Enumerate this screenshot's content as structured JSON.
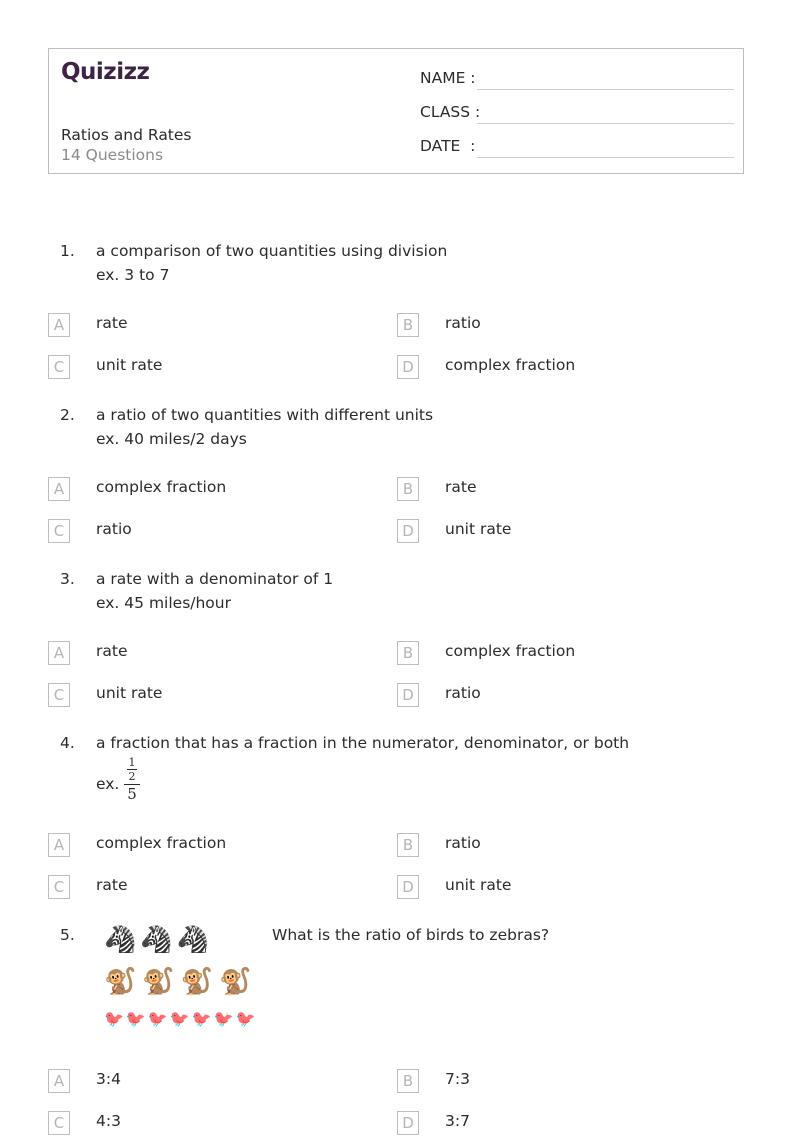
{
  "header": {
    "logo": "Quizizz",
    "worksheet_title": "Ratios and Rates",
    "question_count": "14 Questions",
    "fields": [
      {
        "label": "NAME :"
      },
      {
        "label": "CLASS :"
      },
      {
        "label": "DATE  :"
      }
    ]
  },
  "questions": [
    {
      "number": "1.",
      "text": "a comparison of two quantities using division",
      "example": "ex. 3 to 7",
      "options": [
        {
          "letter": "A",
          "text": "rate"
        },
        {
          "letter": "B",
          "text": "ratio"
        },
        {
          "letter": "C",
          "text": "unit rate"
        },
        {
          "letter": "D",
          "text": "complex fraction"
        }
      ]
    },
    {
      "number": "2.",
      "text": "a ratio of two quantities with different units",
      "example": "ex. 40 miles/2 days",
      "options": [
        {
          "letter": "A",
          "text": "complex fraction"
        },
        {
          "letter": "B",
          "text": "rate"
        },
        {
          "letter": "C",
          "text": "ratio"
        },
        {
          "letter": "D",
          "text": "unit rate"
        }
      ]
    },
    {
      "number": "3.",
      "text": "a rate with a denominator of 1",
      "example": "ex. 45 miles/hour",
      "options": [
        {
          "letter": "A",
          "text": "rate"
        },
        {
          "letter": "B",
          "text": "complex fraction"
        },
        {
          "letter": "C",
          "text": "unit rate"
        },
        {
          "letter": "D",
          "text": "ratio"
        }
      ]
    },
    {
      "number": "4.",
      "text": "a fraction that has a fraction in the numerator, denominator, or both",
      "example_prefix": "ex.",
      "example_fraction": {
        "inner_numerator": "1",
        "inner_denominator": "2",
        "denominator": "5"
      },
      "options": [
        {
          "letter": "A",
          "text": "complex fraction"
        },
        {
          "letter": "B",
          "text": "ratio"
        },
        {
          "letter": "C",
          "text": "rate"
        },
        {
          "letter": "D",
          "text": "unit rate"
        }
      ]
    },
    {
      "number": "5.",
      "text": "What is the ratio of birds to zebras?",
      "image": {
        "rows": [
          {
            "animal": "zebra",
            "count": 3,
            "glyph": "🦓"
          },
          {
            "animal": "monkey",
            "count": 4,
            "glyph": "🐒"
          },
          {
            "animal": "bird",
            "count": 7,
            "glyph": "🐦"
          }
        ]
      },
      "options": [
        {
          "letter": "A",
          "text": "3:4"
        },
        {
          "letter": "B",
          "text": "7:3"
        },
        {
          "letter": "C",
          "text": "4:3"
        },
        {
          "letter": "D",
          "text": "3:7"
        }
      ]
    }
  ]
}
